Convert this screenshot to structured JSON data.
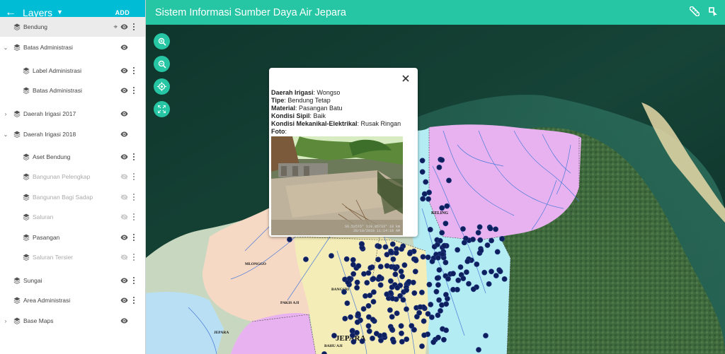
{
  "sidebar": {
    "title": "Layers",
    "add_label": "ADD",
    "layers": [
      {
        "label": "Bendung",
        "level": 0,
        "selected": true,
        "visible": true
      },
      {
        "label": "Batas Administrasi",
        "level": 0,
        "expanded": true,
        "visible": true
      },
      {
        "label": "Label Administrasi",
        "level": 1,
        "visible": true
      },
      {
        "label": "Batas Administrasi",
        "level": 1,
        "visible": true
      },
      {
        "label": "Daerah Irigasi 2017",
        "level": 0,
        "expanded": false,
        "visible": true
      },
      {
        "label": "Daerah Irigasi 2018",
        "level": 0,
        "expanded": true,
        "visible": true
      },
      {
        "label": "Aset Bendung",
        "level": 1,
        "visible": true
      },
      {
        "label": "Bangunan Pelengkap",
        "level": 1,
        "visible": false
      },
      {
        "label": "Bangunan Bagi Sadap",
        "level": 1,
        "visible": false
      },
      {
        "label": "Saluran",
        "level": 1,
        "visible": false
      },
      {
        "label": "Pasangan",
        "level": 1,
        "visible": true
      },
      {
        "label": "Saluran Tersier",
        "level": 1,
        "visible": false
      },
      {
        "label": "Sungai",
        "level": 0,
        "visible": true
      },
      {
        "label": "Area Administrasi",
        "level": 0,
        "visible": true
      },
      {
        "label": "Base Maps",
        "level": 0,
        "expanded": false,
        "visible": true
      }
    ]
  },
  "topbar": {
    "title": "Sistem Informasi Sumber Daya Air Jepara"
  },
  "map": {
    "labels": {
      "keling": "KELING",
      "mlonggo": "MLONGGO",
      "bangsri": "BANGSRI",
      "pakis_aji": "PAKIS AJI",
      "jepara_small": "JEPARA",
      "jepara_big": "JEPARA",
      "bahu_aji": "BAHU AJI"
    }
  },
  "popup": {
    "fields": [
      {
        "key": "Daerah Irigasi",
        "value": ": Wongso"
      },
      {
        "key": "Tipe",
        "value": ": Bendung Tetap"
      },
      {
        "key": "Material",
        "value": ": Pasangan Batu"
      },
      {
        "key": "Kondisi Sipil",
        "value": ": Baik"
      },
      {
        "key": "Kondisi Mekanikal-Elektrikal",
        "value": ": Rusak Ringan"
      },
      {
        "key": "Foto",
        "value": ":"
      }
    ],
    "photo_stamp_line1": "S6.52515° 110.85733° 18 km",
    "photo_stamp_line2": "28/10/2018 11:14:18 AM"
  },
  "colors": {
    "sidebar_header": "#00bcd4",
    "topbar": "#26c6a4",
    "map_button": "#26c6a4",
    "point": "#0d1f5c",
    "region_pink": "#e8b2f0",
    "region_cyan": "#b4ecf3",
    "region_peach": "#f6d9c4",
    "region_yellow": "#f4edb7"
  }
}
